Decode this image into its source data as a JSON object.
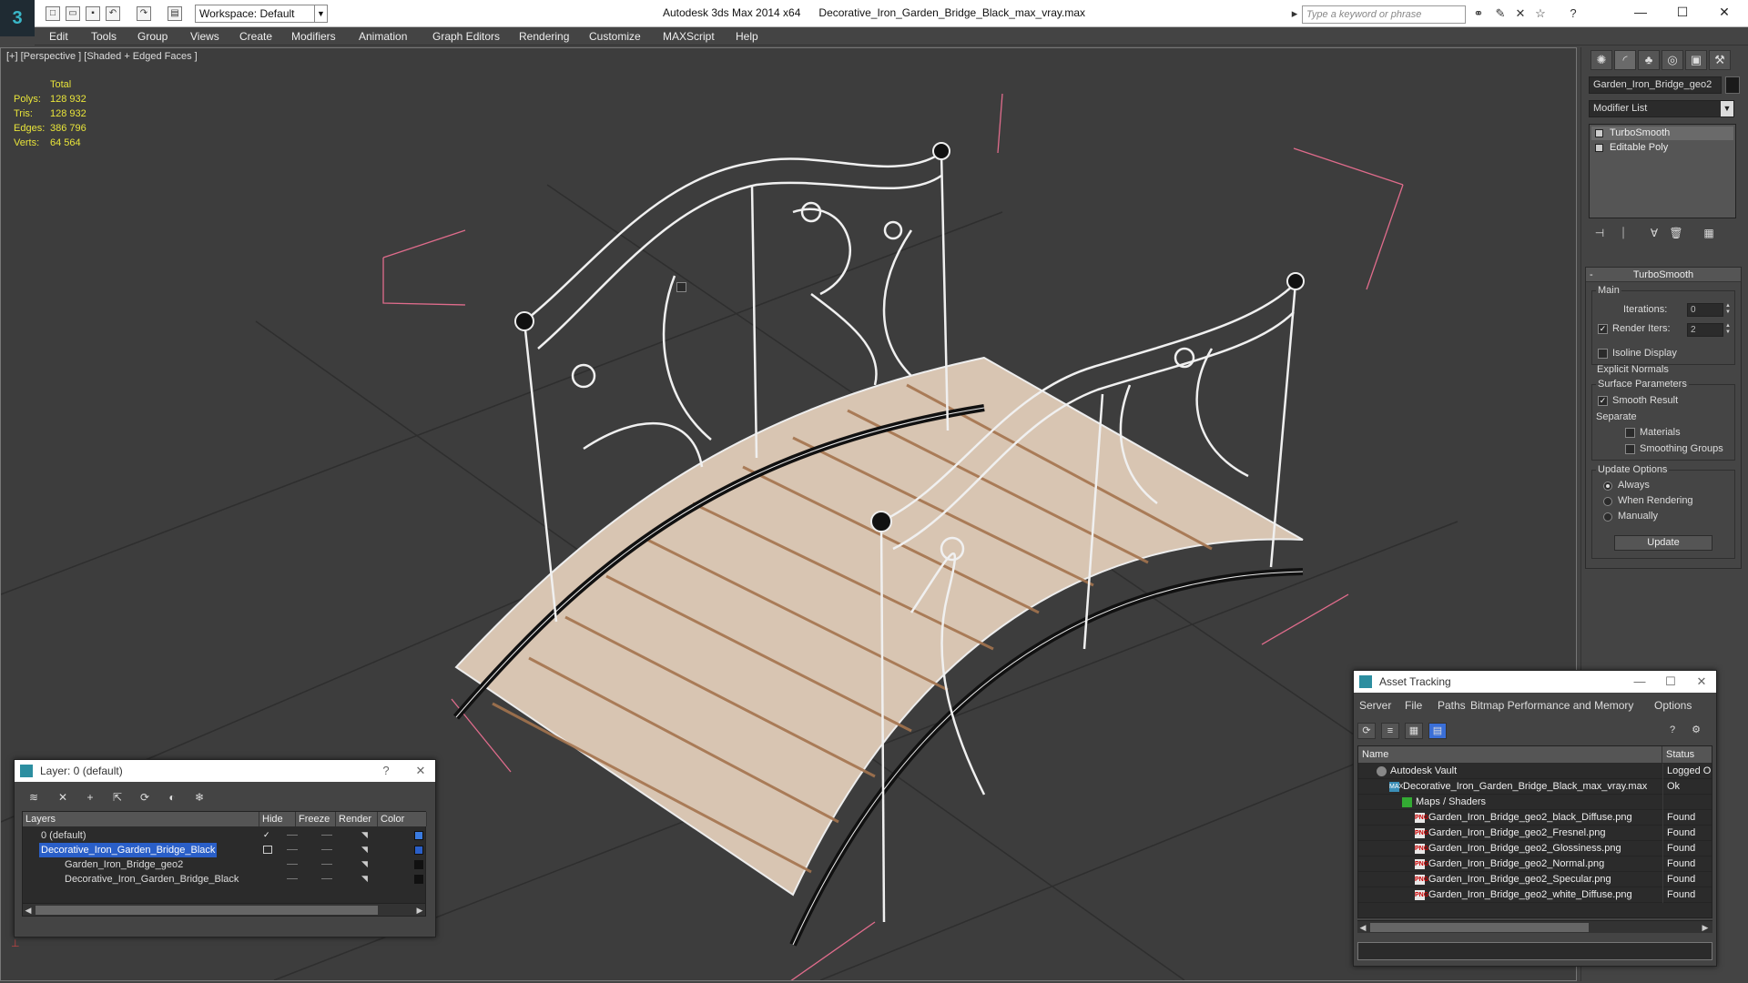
{
  "app": {
    "title_app": "Autodesk 3ds Max  2014 x64",
    "title_file": "Decorative_Iron_Garden_Bridge_Black_max_vray.max",
    "workspace": "Workspace: Default",
    "search_placeholder": "Type a keyword or phrase"
  },
  "menu": [
    "Edit",
    "Tools",
    "Group",
    "Views",
    "Create",
    "Modifiers",
    "Animation",
    "Graph Editors",
    "Rendering",
    "Customize",
    "MAXScript",
    "Help"
  ],
  "viewport": {
    "label": "[+] [Perspective ] [Shaded + Edged Faces ]",
    "stats_header": "Total",
    "stats": [
      {
        "k": "Polys:",
        "v": "128 932"
      },
      {
        "k": "Tris:",
        "v": "128 932"
      },
      {
        "k": "Edges:",
        "v": "386 796"
      },
      {
        "k": "Verts:",
        "v": "64 564"
      }
    ]
  },
  "command_panel": {
    "object_name": "Garden_Iron_Bridge_geo2",
    "modifier_list": "Modifier List",
    "stack": [
      "TurboSmooth",
      "Editable Poly"
    ],
    "turbosmooth": {
      "title": "TurboSmooth",
      "main": "Main",
      "iterations_label": "Iterations:",
      "iterations": "0",
      "render_iters_label": "Render Iters:",
      "render_iters": "2",
      "isoline": "Isoline Display",
      "explicit": "Explicit Normals",
      "surface": "Surface Parameters",
      "smooth_result": "Smooth Result",
      "separate": "Separate",
      "materials": "Materials",
      "smoothing_groups": "Smoothing Groups",
      "update_options": "Update Options",
      "always": "Always",
      "when_rendering": "When Rendering",
      "manually": "Manually",
      "update": "Update"
    }
  },
  "layer_dialog": {
    "title": "Layer: 0 (default)",
    "columns": [
      "Layers",
      "Hide",
      "Freeze",
      "Render",
      "Color"
    ],
    "rows": [
      {
        "name": "0 (default)",
        "color": "#3a7be0"
      },
      {
        "name": "Decorative_Iron_Garden_Bridge_Black",
        "color": "#2a5fc8"
      },
      {
        "name": "Garden_Iron_Bridge_geo2",
        "color": "#111111"
      },
      {
        "name": "Decorative_Iron_Garden_Bridge_Black",
        "color": "#111111"
      }
    ]
  },
  "asset_dialog": {
    "title": "Asset Tracking",
    "menu": [
      "Server",
      "File",
      "Paths",
      "Bitmap Performance and Memory",
      "Options"
    ],
    "columns": [
      "Name",
      "Status"
    ],
    "rows": [
      {
        "name": "Autodesk Vault",
        "status": "Logged O",
        "icon": "vault",
        "indent": 0
      },
      {
        "name": "Decorative_Iron_Garden_Bridge_Black_max_vray.max",
        "status": "Ok",
        "icon": "max",
        "indent": 1
      },
      {
        "name": "Maps / Shaders",
        "status": "",
        "icon": "folder",
        "indent": 2
      },
      {
        "name": "Garden_Iron_Bridge_geo2_black_Diffuse.png",
        "status": "Found",
        "icon": "png",
        "indent": 3
      },
      {
        "name": "Garden_Iron_Bridge_geo2_Fresnel.png",
        "status": "Found",
        "icon": "png",
        "indent": 3
      },
      {
        "name": "Garden_Iron_Bridge_geo2_Glossiness.png",
        "status": "Found",
        "icon": "png",
        "indent": 3
      },
      {
        "name": "Garden_Iron_Bridge_geo2_Normal.png",
        "status": "Found",
        "icon": "png",
        "indent": 3
      },
      {
        "name": "Garden_Iron_Bridge_geo2_Specular.png",
        "status": "Found",
        "icon": "png",
        "indent": 3
      },
      {
        "name": "Garden_Iron_Bridge_geo2_white_Diffuse.png",
        "status": "Found",
        "icon": "png",
        "indent": 3
      }
    ]
  }
}
